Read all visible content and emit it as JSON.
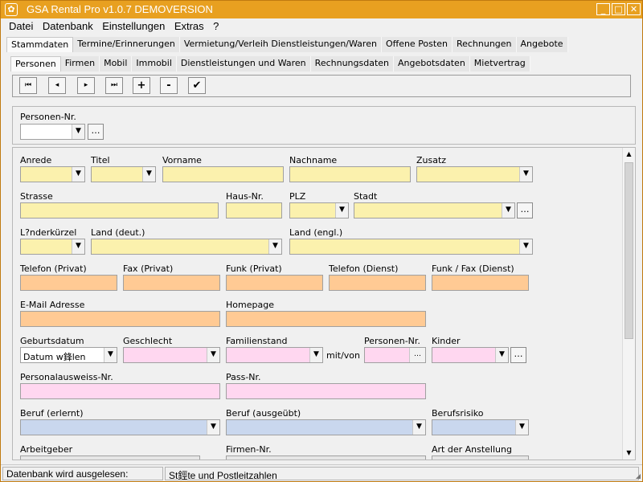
{
  "window": {
    "title": "GSA Rental Pro v1.0.7  DEMOVERSION",
    "icon": "app-flower-icon",
    "controls": {
      "minimize": "_",
      "maximize": "□",
      "close": "✕"
    },
    "accent_color": "#e8a020"
  },
  "menu": {
    "items": [
      "Datei",
      "Datenbank",
      "Einstellungen",
      "Extras",
      "?"
    ]
  },
  "main_tabs": {
    "items": [
      "Stammdaten",
      "Termine/Erinnerungen",
      "Vermietung/Verleih Dienstleistungen/Waren",
      "Offene Posten",
      "Rechnungen",
      "Angebote"
    ],
    "active": "Stammdaten"
  },
  "sub_tabs": {
    "items": [
      "Personen",
      "Firmen",
      "Mobil",
      "Immobil",
      "Dienstleistungen und Waren",
      "Rechnungsdaten",
      "Angebotsdaten",
      "Mietvertrag"
    ],
    "active": "Personen"
  },
  "toolbar": {
    "first": "⏮",
    "prev": "◂",
    "next": "▸",
    "last": "⏭",
    "add": "+",
    "remove": "-",
    "confirm": "✔"
  },
  "top_panel": {
    "personen_nr_label": "Personen-Nr.",
    "personen_nr_value": ""
  },
  "form": {
    "anrede": {
      "label": "Anrede",
      "value": ""
    },
    "titel": {
      "label": "Titel",
      "value": ""
    },
    "vorname": {
      "label": "Vorname",
      "value": ""
    },
    "nachname": {
      "label": "Nachname",
      "value": ""
    },
    "zusatz": {
      "label": "Zusatz",
      "value": ""
    },
    "strasse": {
      "label": "Strasse",
      "value": ""
    },
    "hausnr": {
      "label": "Haus-Nr.",
      "value": ""
    },
    "plz": {
      "label": "PLZ",
      "value": ""
    },
    "stadt": {
      "label": "Stadt",
      "value": ""
    },
    "laenderkuerzel": {
      "label": "L?nderkürzel",
      "value": ""
    },
    "land_deut": {
      "label": "Land (deut.)",
      "value": ""
    },
    "land_engl": {
      "label": "Land (engl.)",
      "value": ""
    },
    "telefon_privat": {
      "label": "Telefon (Privat)",
      "value": ""
    },
    "fax_privat": {
      "label": "Fax (Privat)",
      "value": ""
    },
    "funk_privat": {
      "label": "Funk (Privat)",
      "value": ""
    },
    "telefon_dienst": {
      "label": "Telefon (Dienst)",
      "value": ""
    },
    "funk_fax_dienst": {
      "label": "Funk / Fax  (Dienst)",
      "value": ""
    },
    "email": {
      "label": "E-Mail Adresse",
      "value": ""
    },
    "homepage": {
      "label": "Homepage",
      "value": ""
    },
    "geburtsdatum": {
      "label": "Geburtsdatum",
      "value": "Datum w鋒len"
    },
    "geschlecht": {
      "label": "Geschlecht",
      "value": ""
    },
    "familienstand": {
      "label": "Familienstand",
      "value": ""
    },
    "mit_von": {
      "label": "mit/von"
    },
    "personen_nr2": {
      "label": "Personen-Nr.",
      "value": ""
    },
    "kinder": {
      "label": "Kinder",
      "value": ""
    },
    "ausweis": {
      "label": "Personalausweiss-Nr.",
      "value": ""
    },
    "pass": {
      "label": "Pass-Nr.",
      "value": ""
    },
    "beruf_erlernt": {
      "label": "Beruf (erlernt)",
      "value": ""
    },
    "beruf_ausgeuebt": {
      "label": "Beruf (ausgeübt)",
      "value": ""
    },
    "berufsrisiko": {
      "label": "Berufsrisiko",
      "value": ""
    },
    "arbeitgeber": {
      "label": "Arbeitgeber"
    },
    "firmen_nr": {
      "label": "Firmen-Nr."
    },
    "art_anstellung": {
      "label": "Art der Anstellung"
    }
  },
  "colors": {
    "name_fields": "#fbf1ad",
    "phone_fields": "#ffca94",
    "personal_fields": "#ffd7f0",
    "job_fields": "#c9d7ee"
  },
  "status": {
    "left": "Datenbank wird ausgelesen:",
    "right": "St鋞te und Postleitzahlen"
  }
}
